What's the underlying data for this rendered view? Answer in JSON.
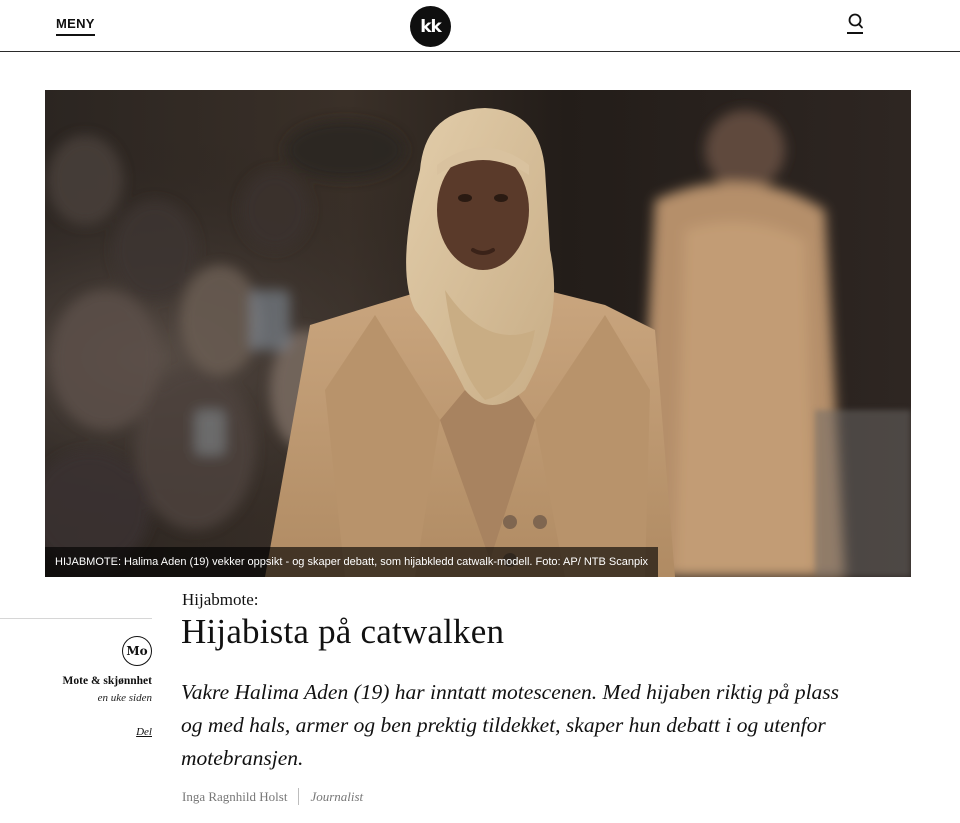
{
  "header": {
    "menu_label": "MENY",
    "logo_text": "kk",
    "search_icon": "search-icon"
  },
  "hero": {
    "caption": "HIJABMOTE: Halima Aden (19) vekker oppsikt - og skaper debatt, som hijabkledd catwalk-modell. Foto: AP/ NTB Scanpix"
  },
  "sidebar": {
    "section_icon_text": "Mo",
    "category": "Mote & skjønnhet",
    "time": "en uke siden",
    "share_label": "Del"
  },
  "article": {
    "kicker": "Hijabmote:",
    "title": "Hijabista på catwalken",
    "lead": "Vakre Halima Aden (19) har inntatt motescenen. Med hijaben riktig på plass og med hals, armer og ben prektig tildekket, skaper hun debatt i og utenfor motebransjen.",
    "author": "Inga Ragnhild Holst",
    "author_role": "Journalist"
  },
  "colors": {
    "text": "#111111",
    "muted": "#777777",
    "logo_bg": "#0f0f0f",
    "coat": "#c4a07a",
    "hijab": "#d9c29f"
  }
}
